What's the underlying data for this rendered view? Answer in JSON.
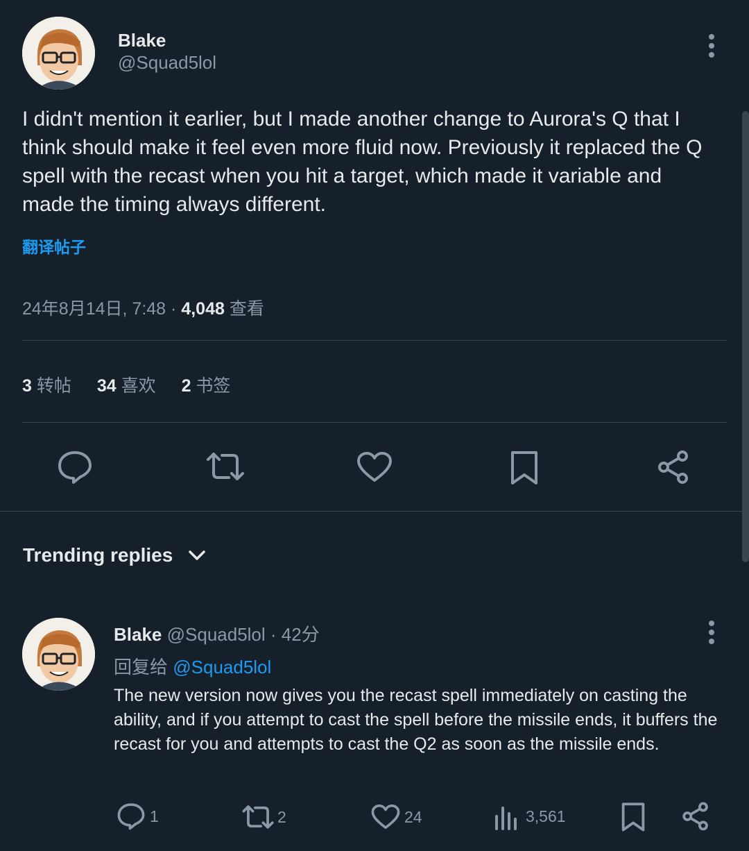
{
  "tweet": {
    "author_name": "Blake",
    "author_handle": "@Squad5lol",
    "body": "I didn't mention it earlier, but I made another change to Aurora's Q that I think should make it feel even more fluid now. Previously it replaced the Q spell with the recast when you hit a target, which made it variable and made the timing always different.",
    "translate_label": "翻译帖子",
    "timestamp": "24年8月14日, 7:48",
    "dot": "·",
    "views_count": "4,048",
    "views_label": "查看",
    "stats": {
      "reposts_count": "3",
      "reposts_label": "转帖",
      "likes_count": "34",
      "likes_label": "喜欢",
      "bookmarks_count": "2",
      "bookmarks_label": "书签"
    }
  },
  "replies_section": {
    "title": "Trending replies"
  },
  "reply": {
    "author_name": "Blake",
    "author_handle": "@Squad5lol",
    "time": "· 42分",
    "replying_to_label": "回复给",
    "replying_to_handle": "@Squad5lol",
    "body": "The new version now gives you the recast spell immediately on casting the ability, and if you attempt to cast the spell before the missile ends, it buffers the recast for you and attempts to cast the Q2 as soon as the missile ends.",
    "actions": {
      "replies": "1",
      "reposts": "2",
      "likes": "24",
      "views": "3,561"
    }
  },
  "colors": {
    "background": "#15202b",
    "text": "#e7e9ea",
    "muted": "#8b98a5",
    "link": "#1d9bf0",
    "divider": "#38444d"
  }
}
